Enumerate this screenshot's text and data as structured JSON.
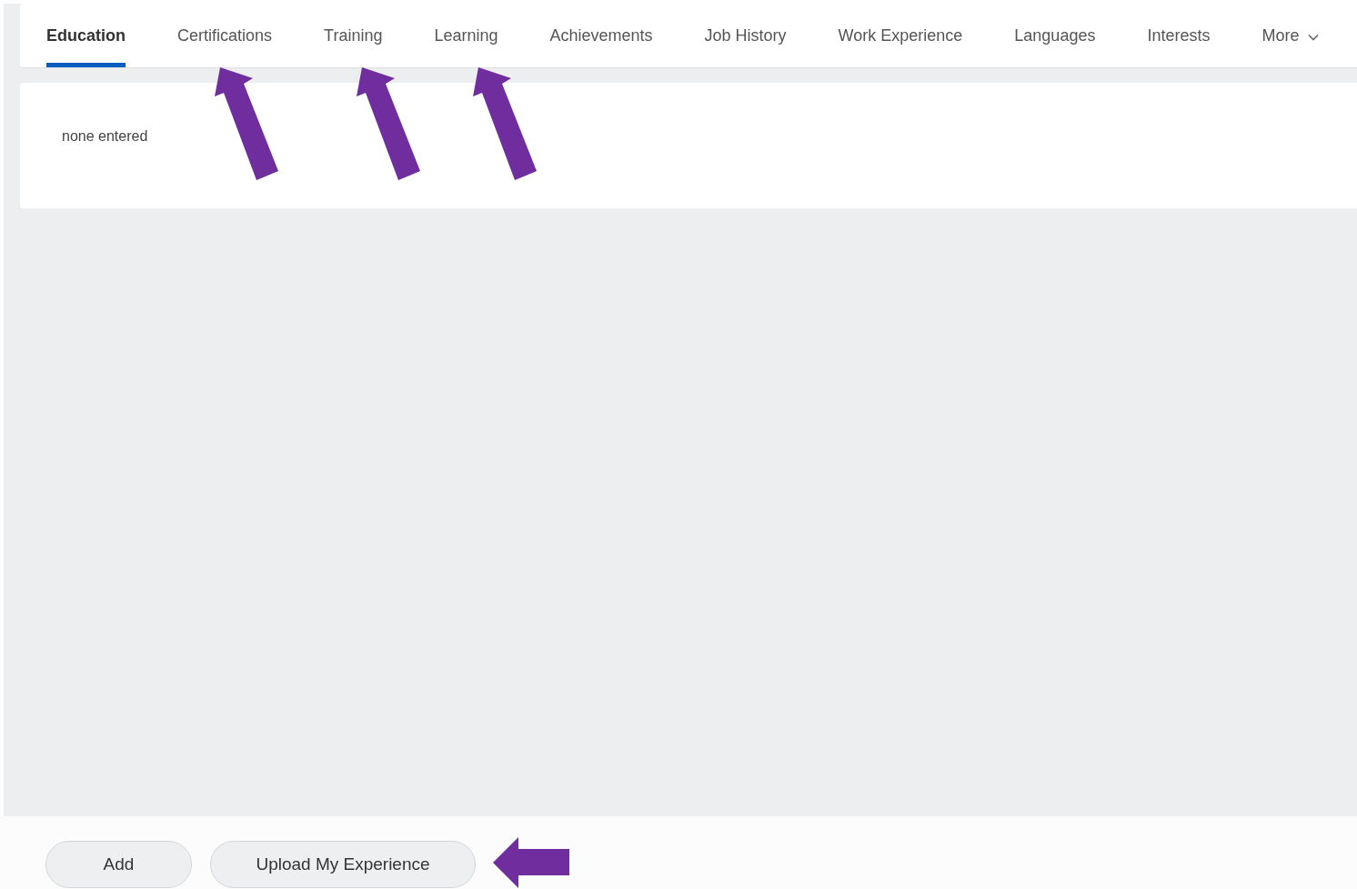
{
  "tabs": [
    {
      "label": "Education",
      "selected": true
    },
    {
      "label": "Certifications",
      "selected": false
    },
    {
      "label": "Training",
      "selected": false
    },
    {
      "label": "Learning",
      "selected": false
    },
    {
      "label": "Achievements",
      "selected": false
    },
    {
      "label": "Job History",
      "selected": false
    },
    {
      "label": "Work Experience",
      "selected": false
    },
    {
      "label": "Languages",
      "selected": false
    },
    {
      "label": "Interests",
      "selected": false
    },
    {
      "label": "More",
      "selected": false,
      "kind": "dropdown"
    }
  ],
  "content": {
    "message": "none entered"
  },
  "buttons": [
    "Add",
    "Upload My Experience"
  ]
}
